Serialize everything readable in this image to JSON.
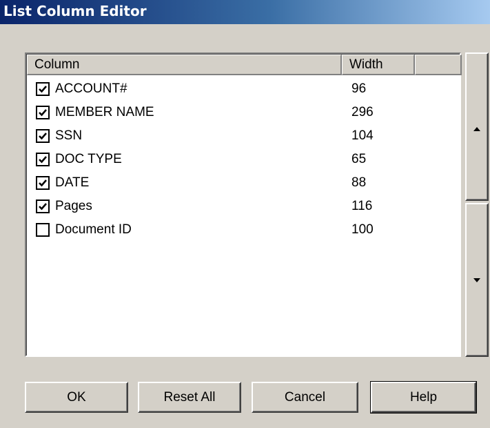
{
  "window": {
    "title": "List Column Editor"
  },
  "list": {
    "headers": {
      "column": "Column",
      "width": "Width"
    },
    "rows": [
      {
        "name": "ACCOUNT#",
        "width": "96",
        "checked": true
      },
      {
        "name": "MEMBER NAME",
        "width": "296",
        "checked": true
      },
      {
        "name": "SSN",
        "width": "104",
        "checked": true
      },
      {
        "name": "DOC TYPE",
        "width": "65",
        "checked": true
      },
      {
        "name": "DATE",
        "width": "88",
        "checked": true
      },
      {
        "name": "Pages",
        "width": "116",
        "checked": true
      },
      {
        "name": "Document ID",
        "width": "100",
        "checked": false
      }
    ]
  },
  "icons": {
    "move_up": "triangle-up-icon",
    "move_down": "triangle-down-icon",
    "check": "checkmark-icon"
  },
  "buttons": {
    "ok": "OK",
    "reset_all": "Reset All",
    "cancel": "Cancel",
    "help": "Help"
  },
  "colors": {
    "title_start": "#0a246a",
    "title_end": "#a6caf0",
    "face": "#d4d0c8"
  }
}
